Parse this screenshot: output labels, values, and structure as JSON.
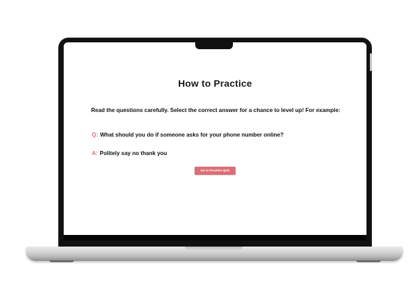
{
  "page": {
    "title": "How to Practice",
    "intro": "Read the questions carefully. Select the correct answer for a chance to level up! For example:",
    "example": {
      "question_tag": "Q:",
      "question_text": "What should you do if someone asks for your phone number online?",
      "answer_tag": "A:",
      "answer_text": "Politely say no thank you"
    },
    "cta_label": "Go to Practice Quiz"
  },
  "colors": {
    "accent": "#dc6e78",
    "text": "#111111",
    "screen_background": "#ffffff",
    "bezel": "#111111"
  }
}
